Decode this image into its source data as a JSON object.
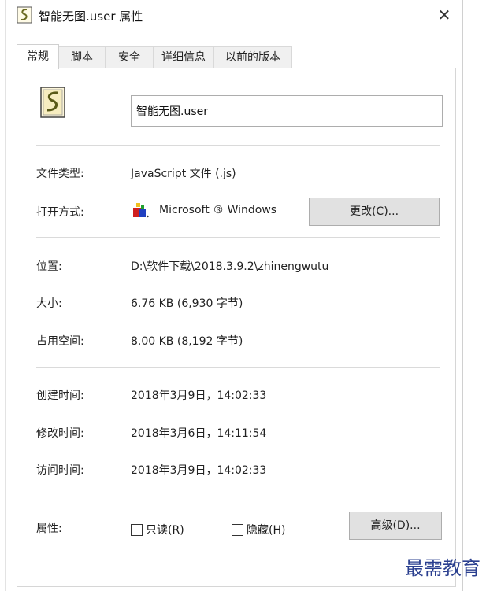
{
  "window": {
    "title": "智能无图.user 属性",
    "close_glyph": "✕"
  },
  "tabs": [
    {
      "label": "常规"
    },
    {
      "label": "脚本"
    },
    {
      "label": "安全"
    },
    {
      "label": "详细信息"
    },
    {
      "label": "以前的版本"
    }
  ],
  "file": {
    "name": "智能无图.user"
  },
  "type_section": {
    "file_type_label": "文件类型:",
    "file_type_value": "JavaScript 文件 (.js)",
    "open_with_label": "打开方式:",
    "open_with_value": "Microsoft ® Windows",
    "change_button": "更改(C)..."
  },
  "location_section": {
    "location_label": "位置:",
    "location_value": "D:\\软件下载\\2018.3.9.2\\zhinengwutu",
    "size_label": "大小:",
    "size_value": "6.76 KB (6,930 字节)",
    "disk_size_label": "占用空间:",
    "disk_size_value": "8.00 KB (8,192 字节)"
  },
  "time_section": {
    "created_label": "创建时间:",
    "created_value": "2018年3月9日，14:02:33",
    "modified_label": "修改时间:",
    "modified_value": "2018年3月6日，14:11:54",
    "accessed_label": "访问时间:",
    "accessed_value": "2018年3月9日，14:02:33"
  },
  "attributes": {
    "label": "属性:",
    "readonly": {
      "label": "只读(R)",
      "checked": false
    },
    "hidden": {
      "label": "隐藏(H)",
      "checked": false
    },
    "advanced_button": "高级(D)..."
  },
  "watermark": "最需教育",
  "colors": {
    "accent_watermark": "#2a3f8f",
    "button_bg": "#e1e1e1"
  },
  "icons": {
    "title": "script-file-icon",
    "file": "script-file-icon",
    "open_with": "windows-script-host-icon"
  }
}
